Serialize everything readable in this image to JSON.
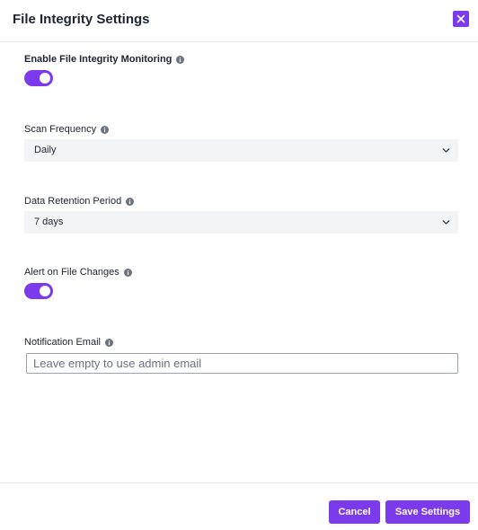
{
  "dialog": {
    "title": "File Integrity Settings"
  },
  "fields": {
    "enable_monitoring": {
      "label": "Enable File Integrity Monitoring",
      "enabled": true
    },
    "scan_frequency": {
      "label": "Scan Frequency",
      "value": "Daily"
    },
    "data_retention": {
      "label": "Data Retention Period",
      "value": "7 days"
    },
    "alert_on_changes": {
      "label": "Alert on File Changes",
      "enabled": true
    },
    "notification_email": {
      "label": "Notification Email",
      "value": "",
      "placeholder": "Leave empty to use admin email"
    }
  },
  "footer": {
    "cancel_label": "Cancel",
    "save_label": "Save Settings"
  },
  "colors": {
    "accent": "#7c3aed",
    "select_bg": "#f3f4f6"
  },
  "icons": {
    "close": "close-icon",
    "info": "info-icon",
    "chevron": "chevron-down-icon"
  }
}
